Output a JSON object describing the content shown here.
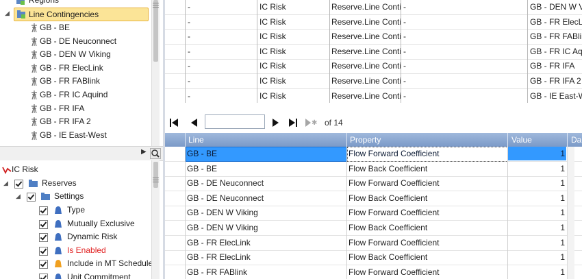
{
  "tree_top": {
    "regions_label": "Regions",
    "line_contingencies_label": "Line Contingencies",
    "items": [
      "GB - BE",
      "GB - DE Neuconnect",
      "GB - DEN W Viking",
      "GB - FR ElecLink",
      "GB - FR FABlink",
      "GB - FR IC Aquind",
      "GB - FR IFA",
      "GB - FR IFA 2",
      "GB - IE East-West"
    ]
  },
  "tree_bottom": {
    "root_label": "IC Risk",
    "reserves_label": "Reserves",
    "settings_label": "Settings",
    "settings_items": [
      "Type",
      "Mutually Exclusive",
      "Dynamic Risk",
      "Is Enabled",
      "Include in MT Schedule",
      "Unit Commitment"
    ]
  },
  "grid_top": {
    "rows": [
      {
        "c1": "-",
        "c2": "IC Risk",
        "c3": "Reserve.Line Contir",
        "c4": "-",
        "c5": "GB - DEN W Vi"
      },
      {
        "c1": "-",
        "c2": "IC Risk",
        "c3": "Reserve.Line Contir",
        "c4": "-",
        "c5": "GB - FR ElecLi"
      },
      {
        "c1": "-",
        "c2": "IC Risk",
        "c3": "Reserve.Line Contir",
        "c4": "-",
        "c5": "GB - FR FABlink"
      },
      {
        "c1": "-",
        "c2": "IC Risk",
        "c3": "Reserve.Line Contir",
        "c4": "-",
        "c5": "GB - FR IC Aqu"
      },
      {
        "c1": "-",
        "c2": "IC Risk",
        "c3": "Reserve.Line Contir",
        "c4": "-",
        "c5": "GB - FR IFA"
      },
      {
        "c1": "-",
        "c2": "IC Risk",
        "c3": "Reserve.Line Contir",
        "c4": "-",
        "c5": "GB - FR IFA 2"
      },
      {
        "c1": "-",
        "c2": "IC Risk",
        "c3": "Reserve.Line Contir",
        "c4": "-",
        "c5": "GB - IE East-We"
      }
    ]
  },
  "pager": {
    "of_label": "of 14",
    "page_value": ""
  },
  "grid_bottom": {
    "columns": [
      "Line",
      "Property",
      "Value",
      "Da"
    ],
    "rows": [
      {
        "line": "GB - BE",
        "property": "Flow Forward Coefficient",
        "value": "1"
      },
      {
        "line": "GB - BE",
        "property": "Flow Back Coefficient",
        "value": "1"
      },
      {
        "line": "GB - DE Neuconnect",
        "property": "Flow Forward Coefficient",
        "value": "1"
      },
      {
        "line": "GB - DE Neuconnect",
        "property": "Flow Back Coefficient",
        "value": "1"
      },
      {
        "line": "GB - DEN W Viking",
        "property": "Flow Forward Coefficient",
        "value": "1"
      },
      {
        "line": "GB - DEN W Viking",
        "property": "Flow Back Coefficient",
        "value": "1"
      },
      {
        "line": "GB - FR ElecLink",
        "property": "Flow Forward Coefficient",
        "value": "1"
      },
      {
        "line": "GB - FR ElecLink",
        "property": "Flow Back Coefficient",
        "value": "1"
      },
      {
        "line": "GB - FR FABlink",
        "property": "Flow Forward Coefficient",
        "value": "1"
      }
    ]
  },
  "colors": {
    "selection": "#fbe497",
    "grid_header": "#7b9ac8",
    "row_selected": "#3399ff",
    "enabled_red": "#e02020"
  }
}
